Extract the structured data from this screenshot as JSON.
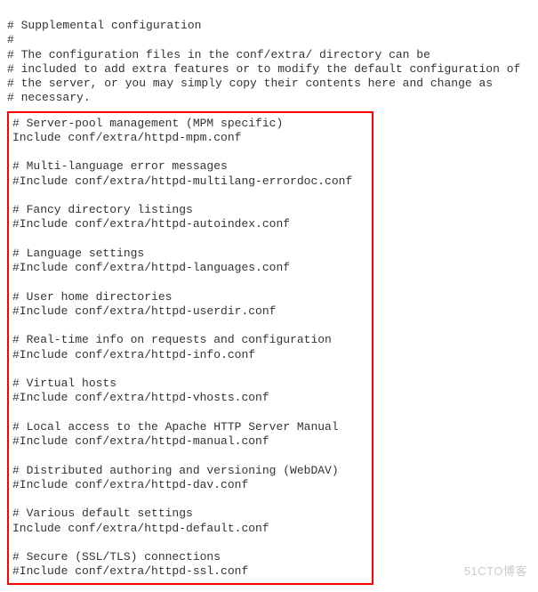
{
  "intro": "# Supplemental configuration\n#\n# The configuration files in the conf/extra/ directory can be\n# included to add extra features or to modify the default configuration of\n# the server, or you may simply copy their contents here and change as\n# necessary.",
  "boxed": "# Server-pool management (MPM specific)\nInclude conf/extra/httpd-mpm.conf\n\n# Multi-language error messages\n#Include conf/extra/httpd-multilang-errordoc.conf\n\n# Fancy directory listings\n#Include conf/extra/httpd-autoindex.conf\n\n# Language settings\n#Include conf/extra/httpd-languages.conf\n\n# User home directories\n#Include conf/extra/httpd-userdir.conf\n\n# Real-time info on requests and configuration\n#Include conf/extra/httpd-info.conf\n\n# Virtual hosts\n#Include conf/extra/httpd-vhosts.conf\n\n# Local access to the Apache HTTP Server Manual\n#Include conf/extra/httpd-manual.conf\n\n# Distributed authoring and versioning (WebDAV)\n#Include conf/extra/httpd-dav.conf\n\n# Various default settings\nInclude conf/extra/httpd-default.conf\n\n# Secure (SSL/TLS) connections\n#Include conf/extra/httpd-ssl.conf",
  "watermark": "51CTO博客"
}
